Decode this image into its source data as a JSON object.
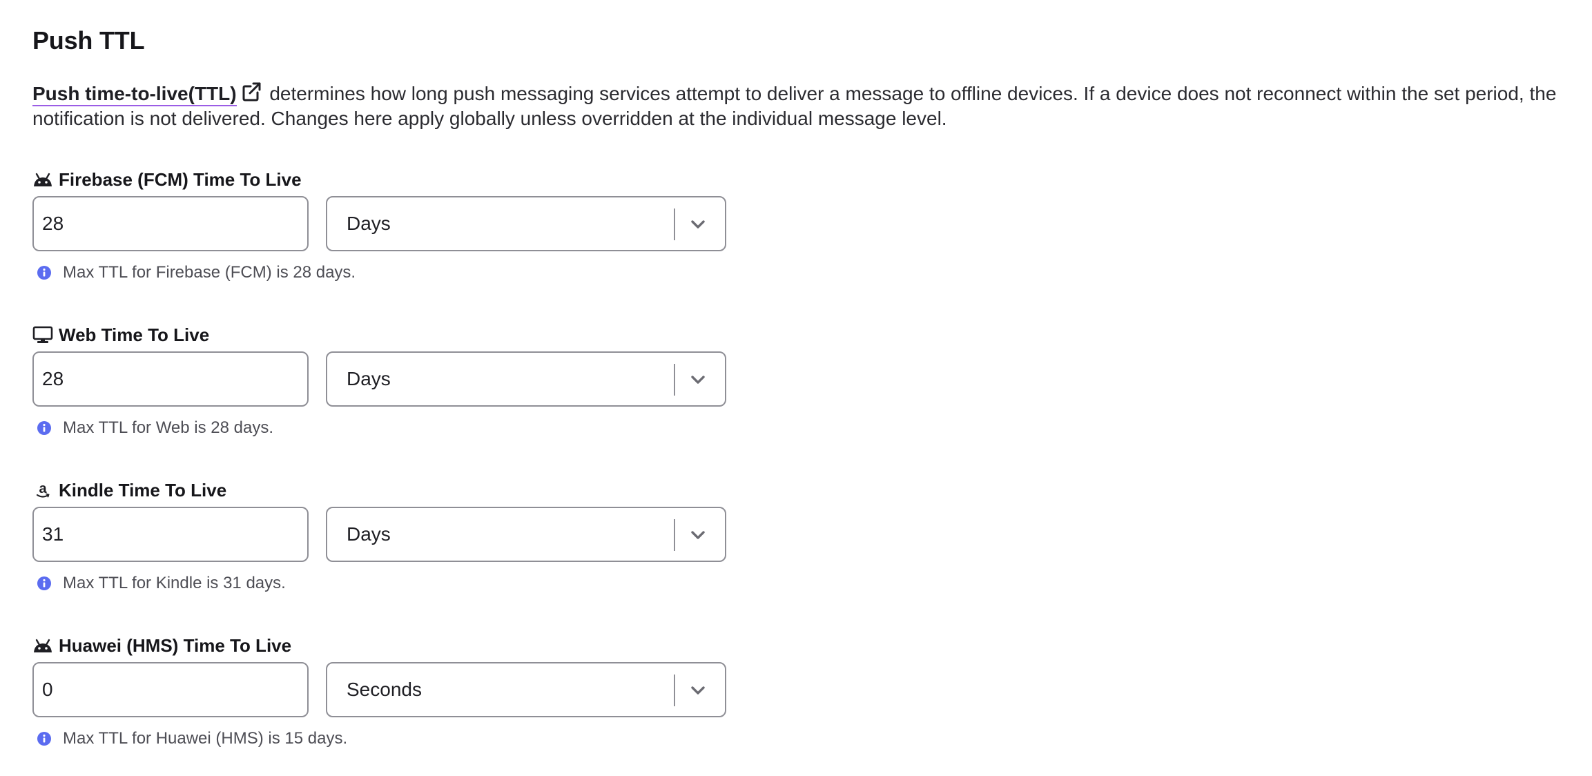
{
  "title": "Push TTL",
  "intro": {
    "link_text": "Push time-to-live(TTL)",
    "link_icon": "external-link-icon",
    "body": "determines how long push messaging services attempt to deliver a message to offline devices. If a device does not reconnect within the set period, the notification is not delivered. Changes here apply globally unless overridden at the individual message level."
  },
  "colors": {
    "link_underline": "#9b5de5",
    "info_icon": "#5b6cf0",
    "border": "#8f8f96"
  },
  "fields": [
    {
      "label": "Firebase (FCM) Time To Live",
      "icon": "android-icon",
      "value": "28",
      "unit": "Days",
      "hint": "Max TTL for Firebase (FCM) is 28 days."
    },
    {
      "label": "Web Time To Live",
      "icon": "desktop-icon",
      "value": "28",
      "unit": "Days",
      "hint": "Max TTL for Web is 28 days."
    },
    {
      "label": "Kindle Time To Live",
      "icon": "amazon-icon",
      "value": "31",
      "unit": "Days",
      "hint": "Max TTL for Kindle is 31 days."
    },
    {
      "label": "Huawei (HMS) Time To Live",
      "icon": "android-icon",
      "value": "0",
      "unit": "Seconds",
      "hint": "Max TTL for Huawei (HMS) is 15 days."
    }
  ]
}
